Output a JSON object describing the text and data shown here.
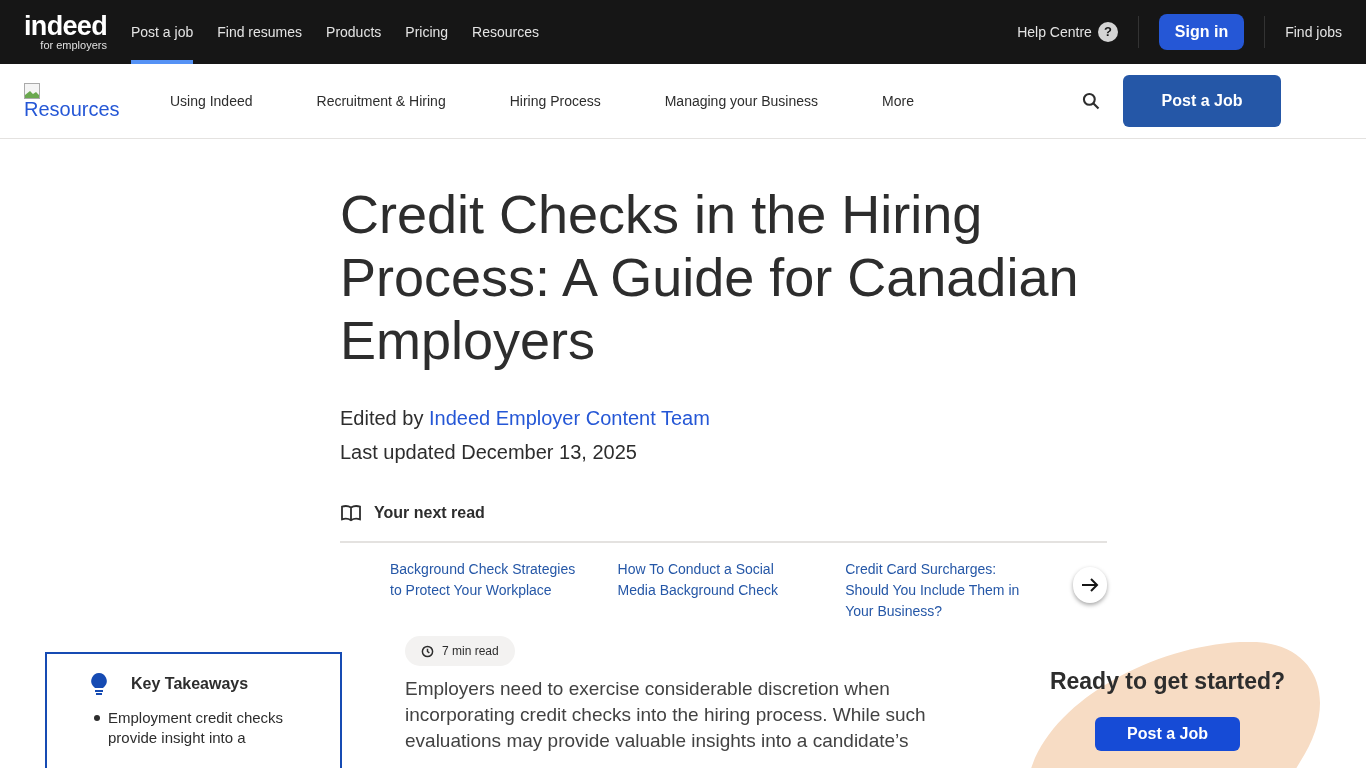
{
  "topbar": {
    "logo": {
      "wordmark": "indeed",
      "tagline": "for employers"
    },
    "nav": [
      {
        "label": "Post a job",
        "selected": true
      },
      {
        "label": "Find resumes",
        "selected": false
      },
      {
        "label": "Products",
        "selected": false
      },
      {
        "label": "Pricing",
        "selected": false
      },
      {
        "label": "Resources",
        "selected": false
      }
    ],
    "help": {
      "label": "Help Centre",
      "icon_text": "?"
    },
    "sign_in": "Sign in",
    "find_jobs": "Find jobs"
  },
  "subnav": {
    "logo_alt": "Resources",
    "items": [
      {
        "label": "Using Indeed"
      },
      {
        "label": "Recruitment & Hiring"
      },
      {
        "label": "Hiring Process"
      },
      {
        "label": "Managing your Business"
      },
      {
        "label": "More"
      }
    ],
    "post_button": "Post a Job"
  },
  "article": {
    "title": "Credit Checks in the Hiring Process: A Guide for Canadian Employers",
    "edited_prefix": "Edited by",
    "editor": "Indeed Employer Content Team",
    "updated": "Last updated December 13, 2025",
    "next_read": {
      "heading": "Your next read",
      "links": [
        "Background Check Strategies to Protect Your Workplace",
        "How To Conduct a Social Media Background Check",
        "Credit Card Surcharges: Should You Include Them in Your Business?"
      ]
    },
    "read_time": "7 min read",
    "intro": "Employers need to exercise considerable discretion when incorporating credit checks into the hiring process. While such evaluations may provide valuable insights into a candidate’s"
  },
  "takeaways": {
    "heading": "Key Takeaways",
    "items": [
      "Employment credit checks provide insight into a"
    ]
  },
  "cta": {
    "heading": "Ready to get started?",
    "button": "Post a Job"
  }
}
